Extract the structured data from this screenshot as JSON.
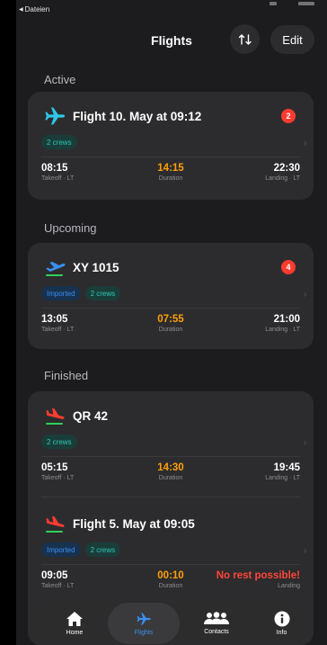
{
  "status": {
    "back_label": "Dateien"
  },
  "header": {
    "title": "Flights",
    "edit_label": "Edit"
  },
  "sections": {
    "active": "Active",
    "upcoming": "Upcoming",
    "finished": "Finished"
  },
  "flights": {
    "active": [
      {
        "name": "Flight 10. May at 09:12",
        "badge": "2",
        "tags": [
          "2 crews"
        ],
        "takeoff": "08:15",
        "takeoff_label": "Takeoff · LT",
        "duration": "14:15",
        "duration_label": "Duration",
        "landing": "22:30",
        "landing_label": "Landing · LT"
      }
    ],
    "upcoming": [
      {
        "name": "XY 1015",
        "badge": "4",
        "tags": [
          "Imported",
          "2 crews"
        ],
        "takeoff": "13:05",
        "takeoff_label": "Takeoff · LT",
        "duration": "07:55",
        "duration_label": "Duration",
        "landing": "21:00",
        "landing_label": "Landing · LT"
      }
    ],
    "finished": [
      {
        "name": "QR 42",
        "tags": [
          "2 crews"
        ],
        "takeoff": "05:15",
        "takeoff_label": "Takeoff · LT",
        "duration": "14:30",
        "duration_label": "Duration",
        "landing": "19:45",
        "landing_label": "Landing · LT"
      },
      {
        "name": "Flight 5. May at 09:05",
        "tags": [
          "Imported",
          "2 crews"
        ],
        "takeoff": "09:05",
        "takeoff_label": "Takeoff · LT",
        "duration": "00:10",
        "duration_label": "Duration",
        "landing": "No rest possible!",
        "landing_label": "Landing"
      }
    ]
  },
  "tabbar": {
    "items": [
      {
        "label": "Home",
        "icon": "house-icon"
      },
      {
        "label": "Flights",
        "icon": "airplane-icon"
      },
      {
        "label": "Contacts",
        "icon": "people-icon"
      },
      {
        "label": "Info",
        "icon": "info-icon"
      }
    ],
    "active": "Flights"
  },
  "colors": {
    "takeoff_plane": "#2fc7e8",
    "upcoming_plane": "#3a8ff0",
    "finished_plane": "#ff3b30",
    "duration": "#ff9f0a",
    "accent": "#3a8ff0",
    "badge": "#ff3b30"
  }
}
